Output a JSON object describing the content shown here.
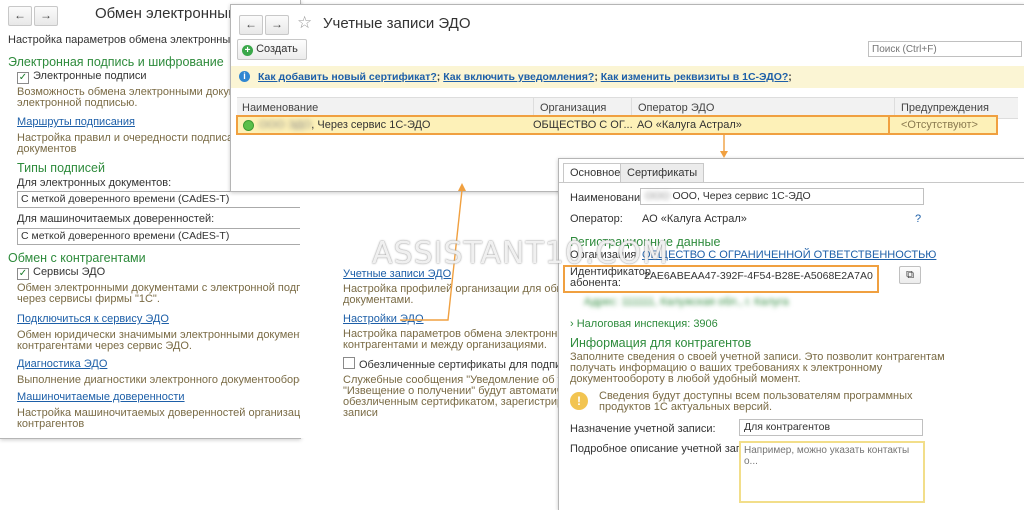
{
  "settings": {
    "title": "Обмен электронными",
    "description": "Настройка параметров обмена электронными до",
    "sig_section": "Электронная подпись и шифрование",
    "sig_checkbox": "Электронные подписи",
    "sig_desc1": "Возможность обмена электронными документа",
    "sig_desc2": "электронной подписью.",
    "routes_link": "Маршруты подписания",
    "routes_desc1": "Настройка правил и очередности подписания",
    "routes_desc2": "документов",
    "types_section": "Типы подписей",
    "edoc_label": "Для электронных документов:",
    "edoc_value": "С меткой доверенного времени (CAdES-T)",
    "mchd_label": "Для машиночитаемых доверенностей:",
    "mchd_value": "С меткой доверенного времени (CAdES-T)",
    "contr_section": "Обмен с контрагентами",
    "edo_checkbox": "Сервисы ЭДО",
    "edo_desc1": "Обмен электронными документами с электронной подписью",
    "edo_desc2": "через сервисы фирмы \"1С\".",
    "connect_link": "Подключиться к сервису ЭДО",
    "connect_desc1": "Обмен юридически значимыми электронными документами с",
    "connect_desc2": "контрагентами через сервис ЭДО.",
    "diag_link": "Диагностика ЭДО",
    "diag_desc": "Выполнение диагностики электронного документооборота",
    "mchd_link": "Машиночитаемые доверенности",
    "mchd_desc1": "Настройка машиночитаемых доверенностей организаций и",
    "mchd_desc2": "контрагентов",
    "accounts_link": "Учетные записи ЭДО",
    "accounts_desc1": "Настройка профилей организации для обмена",
    "accounts_desc2": "документами.",
    "edo_settings_link": "Настройки ЭДО",
    "edo_settings_desc1": "Настройка параметров обмена электронными",
    "edo_settings_desc2": "контрагентами и между организациями.",
    "impersonal_checkbox": "Обезличенные сертификаты для подписи с",
    "service_desc1": "Служебные сообщения \"Уведомление об уточ",
    "service_desc2": "\"Извещение о получении\" будут автоматич",
    "service_desc3": "обезличенным сертификатом, зарегистриров",
    "service_desc4": "записи"
  },
  "accounts": {
    "title": "Учетные записи ЭДО",
    "create_button": "Создать",
    "search_placeholder": "Поиск (Ctrl+F)",
    "info_link1": "Как добавить новый сертификат?",
    "info_sep1": ";",
    "info_link2": "Как включить уведомления?",
    "info_sep2": ";",
    "info_link3": "Как изменить реквизиты в 1С-ЭДО?",
    "info_sep3": ";",
    "columns": [
      "Наименование",
      "Организация",
      "Оператор ЭДО",
      "Предупреждения"
    ],
    "row": {
      "name_blurred": "ООО ЭДО",
      "name": ", Через сервис 1С-ЭДО",
      "org": "ОБЩЕСТВО С ОГ...",
      "operator": "АО «Калуга Астрал»",
      "warning": "<Отсутствуют>"
    }
  },
  "detail": {
    "tab_main": "Основное",
    "tab_certs": "Сертификаты",
    "name_label": "Наименование:",
    "name_blurred": "ООО",
    "name_value": "ООО, Через сервис 1С-ЭДО",
    "operator_label": "Оператор:",
    "operator_value": "АО «Калуга Астрал»",
    "help": "?",
    "reg_section": "Регистрационные данные",
    "org_label": "Организация:",
    "org_value": "ОБЩЕСТВО С ОГРАНИЧЕННОЙ ОТВЕТСТВЕННОСТЬЮ",
    "id_label1": "Идентификатор",
    "id_label2": "абонента:",
    "id_value": "2AE6ABEAA47-392F-4F54-B28E-A5068E2A7A0",
    "blurred_line": "Адрес: 111111, Калужская обл., г. Калуга",
    "tax_label": "Налоговая инспекция: 3906",
    "info_section": "Информация для контрагентов",
    "info_desc1": "Заполните сведения о своей учетной записи. Это позволит контрагентам",
    "info_desc2": "получать информацию о ваших требованиях к электронному",
    "info_desc3": "документообороту в любой удобный момент.",
    "note1": "Сведения будут доступны всем пользователям программных",
    "note2": "продуктов 1С актуальных версий.",
    "purpose_label": "Назначение учетной записи:",
    "purpose_value": "Для контрагентов",
    "desc_label": "Подробное описание учетной записи:",
    "desc_placeholder": "Например, можно указать контакты о..."
  },
  "watermark": "ASSISTANT10.COM",
  "colors": {
    "accent_orange": "#f0a040",
    "section_green": "#2e8b3c",
    "link_blue": "#1d5fa8"
  }
}
